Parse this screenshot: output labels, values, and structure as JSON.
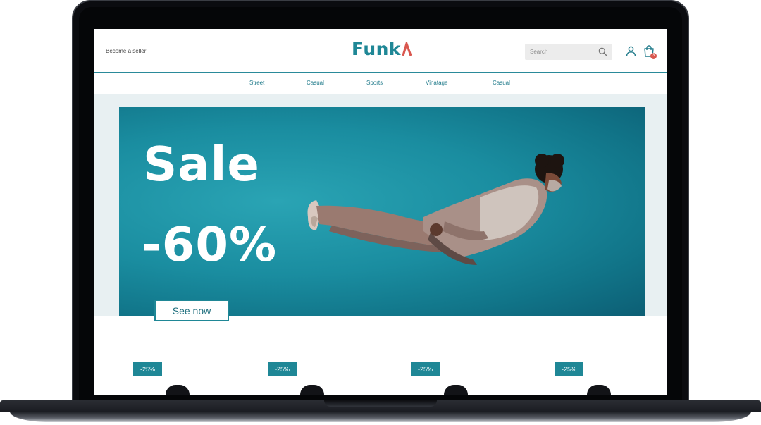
{
  "header": {
    "seller_link": "Become a seller",
    "logo_text": "Funk",
    "search_placeholder": "Search",
    "cart_count": "3"
  },
  "categories": [
    "Street",
    "Casual",
    "Sports",
    "Vinatage",
    "Casual"
  ],
  "hero": {
    "title": "Sale",
    "discount": "-60%",
    "cta_label": "See now"
  },
  "products": [
    {
      "badge": "-25%"
    },
    {
      "badge": "-25%"
    },
    {
      "badge": "-25%"
    },
    {
      "badge": "-25%"
    }
  ],
  "colors": {
    "brand": "#1f8796",
    "accent": "#d9574f",
    "hero_bg": "#1a8da0"
  },
  "icons": [
    "search-icon",
    "user-icon",
    "shopping-bag-icon"
  ]
}
